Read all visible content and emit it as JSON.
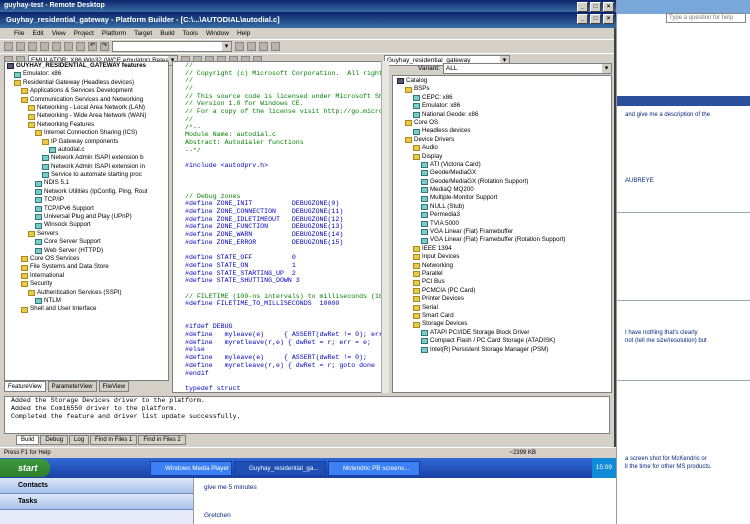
{
  "remote_desktop": {
    "title": "guyhay-test - Remote Desktop"
  },
  "platform_builder": {
    "title": "Guyhay_residential_gateway - Platform Builder - [C:\\...\\AUTODIAL\\autodial.c]",
    "menu": [
      "File",
      "Edit",
      "View",
      "Project",
      "Platform",
      "Target",
      "Build",
      "Tools",
      "Window",
      "Help"
    ],
    "config_combo": "EMULATOR: X86 Win32 (WCE emulator) Release",
    "workspace_combo": "Guyhay_residential_gateway"
  },
  "feature_tree": {
    "root": "GUYHAY_RESIDENTIAL_GATEWAY features",
    "items": [
      "Emulator: x86",
      "Residential Gateway (Headless devices)",
      "Applications & Services Development",
      "Communication Services and Networking",
      "Networking - Local Area Network (LAN)",
      "Networking - Wide Area Network (WAN)",
      "Networking Features",
      "Internet Connection Sharing (ICS)",
      "IP Gateway components",
      "autodial.c",
      "Network Admin ISAPI extension b",
      "Network Admin ISAPI extension in",
      "Service to automate starting proc",
      "NDIS 5.1",
      "Network Utilities (IpConfig, Ping, Rout",
      "TCP/IP",
      "TCP/IPv6 Support",
      "Universal Plug and Play (UPnP)",
      "Winsock Support",
      "Servers",
      "Core Server Support",
      "Web Server (HTTPD)",
      "Core OS Services",
      "File Systems and Data Store",
      "International",
      "Security",
      "Authentication Services (SSPI)",
      "NTLM",
      "Shell and User Interface"
    ],
    "indents": [
      1,
      1,
      2,
      2,
      3,
      3,
      3,
      4,
      5,
      6,
      5,
      5,
      5,
      4,
      4,
      4,
      4,
      4,
      4,
      3,
      4,
      4,
      2,
      2,
      2,
      2,
      3,
      4,
      2
    ],
    "icons": [
      "comp",
      "folder",
      "folder",
      "folder",
      "folder",
      "folder",
      "folder",
      "folder",
      "folder",
      "comp",
      "comp",
      "comp",
      "comp",
      "comp",
      "comp",
      "comp",
      "comp",
      "comp",
      "comp",
      "folder",
      "comp",
      "comp",
      "folder",
      "folder",
      "folder",
      "folder",
      "folder",
      "comp",
      "folder"
    ],
    "tabs": [
      "FeatureView",
      "ParameterView",
      "FileView"
    ]
  },
  "code": {
    "lines": [
      [
        "cm",
        "//"
      ],
      [
        "cm",
        "// Copyright (c) Microsoft Corporation.  All right"
      ],
      [
        "cm",
        "//"
      ],
      [
        "cm",
        "//"
      ],
      [
        "cm",
        "// This source code is licensed under Microsoft Sh"
      ],
      [
        "cm",
        "// Version 1.0 for Windows CE."
      ],
      [
        "cm",
        "// For a copy of the license visit http://go.micro"
      ],
      [
        "cm",
        "//"
      ],
      [
        "cm",
        "/*--"
      ],
      [
        "cm",
        "Module Name: autodial.c"
      ],
      [
        "cm",
        "Abstract: Autodialer functions"
      ],
      [
        "cm",
        "--*/"
      ],
      [
        "",
        ""
      ],
      [
        "kw",
        "#include <autodprv.h>"
      ],
      [
        "",
        ""
      ],
      [
        "",
        ""
      ],
      [
        "",
        ""
      ],
      [
        "cm",
        "// Debug zones"
      ],
      [
        "kw",
        "#define ZONE_INIT          DEBUGZONE(0)"
      ],
      [
        "kw",
        "#define ZONE_CONNECTION    DEBUGZONE(11)"
      ],
      [
        "kw",
        "#define ZONE_IDLETIMEOUT   DEBUGZONE(12)"
      ],
      [
        "kw",
        "#define ZONE_FUNCTION      DEBUGZONE(13)"
      ],
      [
        "kw",
        "#define ZONE_WARN          DEBUGZONE(14)"
      ],
      [
        "kw",
        "#define ZONE_ERROR         DEBUGZONE(15)"
      ],
      [
        "",
        ""
      ],
      [
        "kw",
        "#define STATE_OFF          0"
      ],
      [
        "kw",
        "#define STATE_ON           1"
      ],
      [
        "kw",
        "#define STATE_STARTING_UP  2"
      ],
      [
        "kw",
        "#define STATE_SHUTTING_DOWN 3"
      ],
      [
        "",
        ""
      ],
      [
        "cm",
        "// FILETIME (100-ns intervals) to milliseconds (10"
      ],
      [
        "kw",
        "#define FILETIME_TO_MILLISECONDS  10000"
      ],
      [
        "",
        ""
      ],
      [
        "",
        ""
      ],
      [
        "kw",
        "#ifdef DEBUG"
      ],
      [
        "kw",
        "#define   myleave(e)     { ASSERT(dwRet != 0); err"
      ],
      [
        "kw",
        "#define   myretleave(r,e) { dwRet = r; err = e;"
      ],
      [
        "kw",
        "#else"
      ],
      [
        "kw",
        "#define   myleave(e)     { ASSERT(dwRet != 0);"
      ],
      [
        "kw",
        "#define   myretleave(r,e) { dwRet = r; goto done"
      ],
      [
        "kw",
        "#endif"
      ],
      [
        "",
        ""
      ],
      [
        "kw",
        "typedef struct"
      ]
    ]
  },
  "catalog": {
    "variant_label": "Variant:",
    "variant_value": "ALL",
    "items": [
      "Catalog",
      "BSPs",
      "CEPC: x86",
      "Emulator: x86",
      "National Geode: x86",
      "Core OS",
      "Headless devices",
      "Device Drivers",
      "Audio",
      "Display",
      "ATI (Victoria Card)",
      "Geode/MediaGX",
      "Geode/MediaGX (Rotation Support)",
      "MediaQ MQ200",
      "Multiple-Monitor Support",
      "NULL (Stub)",
      "Permedia3",
      "TVIA 5000",
      "VGA Linear (Flat) Framebuffer",
      "VGA Linear (Flat) Framebuffer (Rotation Support)",
      "IEEE 1394",
      "Input Devices",
      "Networking",
      "Parallel",
      "PCI Bus",
      "PCMCIA (PC Card)",
      "Printer Devices",
      "Serial",
      "Smart Card",
      "Storage Devices",
      "ATAPI PCI/IDE Storage Block Driver",
      "Compact Flash / PC Card Storage (ATADISK)",
      "Intel(R) Persistent Storage Manager (PSM)"
    ],
    "indents": [
      0,
      1,
      2,
      2,
      2,
      1,
      2,
      1,
      2,
      2,
      3,
      3,
      3,
      3,
      3,
      3,
      3,
      3,
      3,
      3,
      2,
      2,
      2,
      2,
      2,
      2,
      2,
      2,
      2,
      2,
      3,
      3,
      3
    ],
    "icons": [
      "root",
      "folder",
      "comp",
      "comp",
      "comp",
      "folder",
      "comp",
      "folder",
      "folder",
      "folder",
      "comp",
      "comp",
      "comp",
      "comp",
      "comp",
      "comp",
      "comp",
      "comp",
      "comp",
      "comp",
      "folder",
      "folder",
      "folder",
      "folder",
      "folder",
      "folder",
      "folder",
      "folder",
      "folder",
      "folder",
      "comp",
      "comp",
      "comp"
    ]
  },
  "output": {
    "lines": [
      "Added the Storage Devices driver to the platform.",
      "Added the Com16550 driver to the platform.",
      "Completed the feature and driver list update successfully."
    ],
    "tabs": [
      "Build",
      "Debug",
      "Log",
      "Find in Files 1",
      "Find in Files 2"
    ]
  },
  "status": {
    "text": "Press F1 for Help",
    "right": "~2399 KB"
  },
  "taskbar": {
    "start": "start",
    "tasks": [
      "Windows Media Player",
      "Guyhay_residential_ga...",
      "Mctendric PB screens..."
    ],
    "clock": "15:09"
  },
  "background_page": {
    "search_placeholder": "Type a question for help",
    "lines": [
      "and give me a description of the",
      "AUBREYE",
      "I have nothing that's clearly",
      "not (tell me size/resolution) but",
      "a screen shot for McKendric or",
      "ll the time for other MS products."
    ]
  },
  "outlook": {
    "nav": [
      "Contacts",
      "Tasks"
    ],
    "messages": [
      "give me 5 minutes",
      "Gretchen"
    ]
  }
}
